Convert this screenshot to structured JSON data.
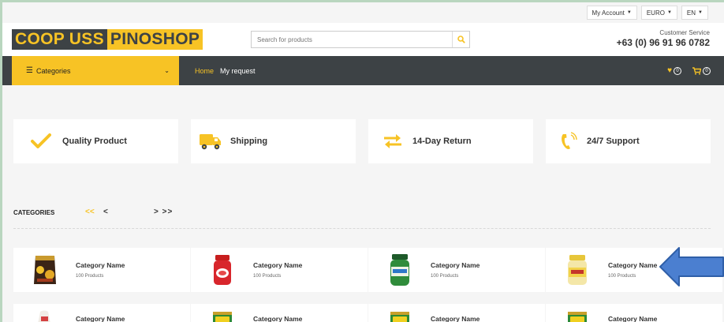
{
  "topbar": {
    "account": "My Account",
    "currency": "EURO",
    "language": "EN"
  },
  "header": {
    "logo_part1": "COOP USS",
    "logo_part2": "PINOSHOP",
    "search_placeholder": "Search for products",
    "cs_label": "Customer Service",
    "cs_phone": "+63 (0) 96 91 96 0782"
  },
  "nav": {
    "categories_label": "Categories",
    "links": [
      "Home",
      "My request"
    ],
    "wishlist_count": "0",
    "cart_count": "0"
  },
  "features": [
    {
      "label": "Quality Product",
      "icon": "check-icon"
    },
    {
      "label": "Shipping",
      "icon": "truck-icon"
    },
    {
      "label": "14-Day Return",
      "icon": "exchange-arrows-icon"
    },
    {
      "label": "24/7 Support",
      "icon": "phone-icon"
    }
  ],
  "categories_section": {
    "title": "CATEGORIES",
    "prev_first": "<<",
    "prev": "<",
    "next": ">",
    "next_last": ">>"
  },
  "categories": [
    {
      "name": "Category Name",
      "count": "100 Products",
      "product": "chocolate-snack-pack"
    },
    {
      "name": "Category Name",
      "count": "100 Products",
      "product": "jam-jar"
    },
    {
      "name": "Category Name",
      "count": "100 Products",
      "product": "green-jar"
    },
    {
      "name": "Category Name",
      "count": "100 Products",
      "product": "mayonnaise-jar"
    },
    {
      "name": "Category Name",
      "product": "cookie-pack"
    },
    {
      "name": "Category Name",
      "product": "milo-can"
    },
    {
      "name": "Category Name",
      "product": "milo-can"
    },
    {
      "name": "Category Name",
      "product": "milo-can"
    }
  ],
  "colors": {
    "accent": "#f7c325",
    "dark": "#3d4245",
    "annotation_arrow": "#4b7fd0"
  }
}
